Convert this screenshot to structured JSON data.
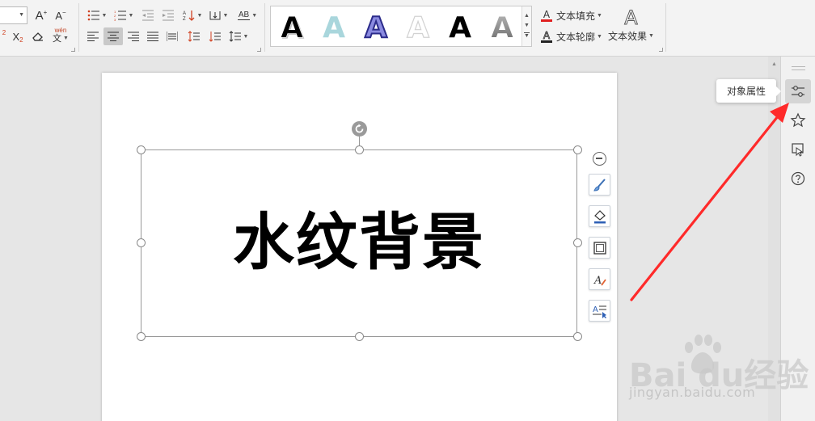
{
  "ribbon": {
    "paragraph_buttons": [
      {
        "name": "bullets-button",
        "icon": "bullet-list-icon"
      },
      {
        "name": "numbering-button",
        "icon": "numbered-list-icon"
      },
      {
        "name": "decrease-indent-button",
        "icon": "decrease-indent-icon"
      },
      {
        "name": "increase-indent-button",
        "icon": "increase-indent-icon"
      },
      {
        "name": "sort-button",
        "icon": "sort-icon"
      },
      {
        "name": "line-break-button",
        "icon": "line-break-icon"
      },
      {
        "name": "char-shading-button",
        "label": "AB"
      }
    ],
    "font_buttons": {
      "grow_font": "A",
      "shrink_font": "A",
      "subscript": "X",
      "subscript_mark": "2",
      "superscript_mark": "2",
      "phonetic_top": "wén",
      "phonetic_bottom": "文"
    },
    "alignment_selected": "center",
    "text_fill_label": "文本填充",
    "text_outline_label": "文本轮廓",
    "text_effect_label": "文本效果",
    "text_effect_glyph": "A",
    "gallery": {
      "glyph": "A",
      "styles": [
        {
          "fill": "#000000",
          "stroke": "#ffffff",
          "shadow": true
        },
        {
          "fill": "#a9d6dc",
          "stroke": "#ffffff",
          "shadow": false
        },
        {
          "fill": "#6e6ec9",
          "stroke": "#2b2b8a",
          "shadow": false
        },
        {
          "fill": "#ffffff",
          "stroke": "#cfcfcf",
          "shadow": false
        },
        {
          "fill": "#000000",
          "stroke": "#000000",
          "shadow": false
        },
        {
          "fill": "#9a9a9a",
          "stroke": "#ffffff",
          "shadow": false
        }
      ]
    },
    "colors": {
      "fill_underline": "#e02020",
      "outline_underline": "#222222"
    }
  },
  "document": {
    "watermark_text": "水纹背景"
  },
  "float_toolbar": [
    {
      "name": "style-brush-button",
      "icon": "brush-icon"
    },
    {
      "name": "shape-fill-button",
      "icon": "fill-bucket-icon"
    },
    {
      "name": "shape-outline-button",
      "icon": "outline-icon"
    },
    {
      "name": "text-fill-button",
      "icon": "text-fill-icon"
    },
    {
      "name": "text-wrap-button",
      "icon": "text-wrap-icon"
    }
  ],
  "right_panel": {
    "tooltip": "对象属性",
    "buttons": [
      {
        "name": "object-properties-button",
        "icon": "sliders-icon",
        "active": true
      },
      {
        "name": "favorites-button",
        "icon": "star-icon",
        "active": false
      },
      {
        "name": "selection-pane-button",
        "icon": "window-icon",
        "active": false
      },
      {
        "name": "help-button",
        "icon": "help-icon",
        "active": false
      }
    ]
  },
  "annotation": {
    "arrow_color": "#ff2a2a"
  },
  "site_watermark": {
    "logo": "Bai  du经验",
    "url": "jingyan.baidu.com"
  }
}
